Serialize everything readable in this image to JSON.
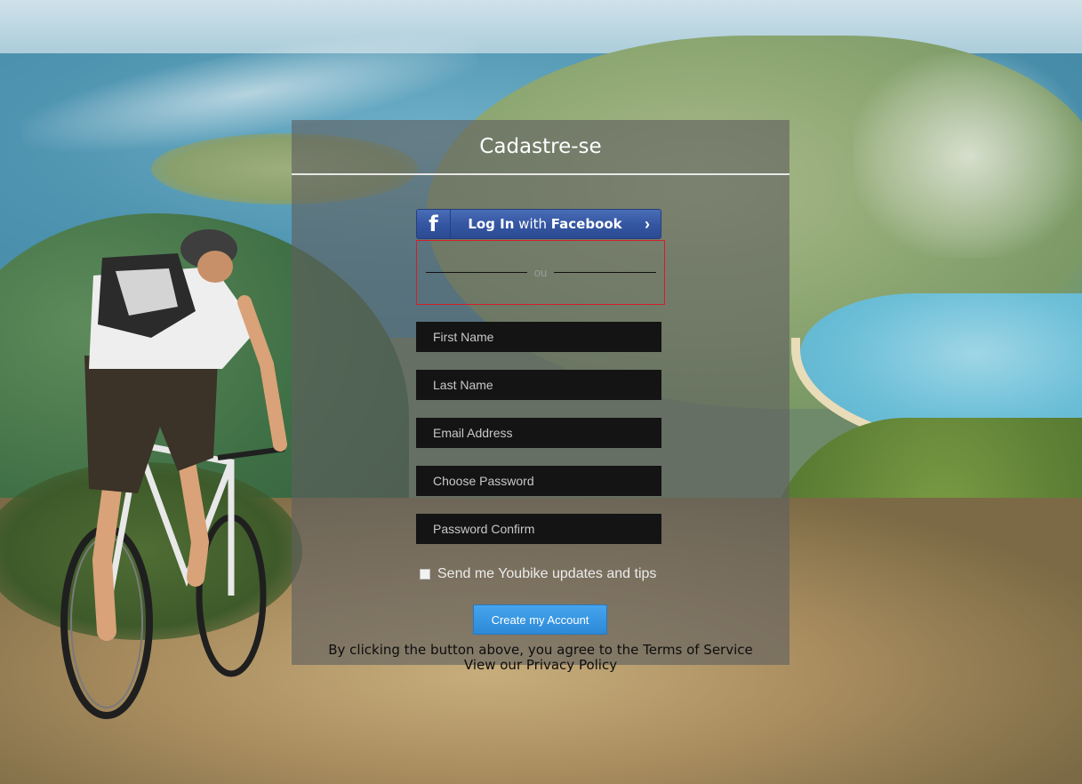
{
  "panel": {
    "title": "Cadastre-se"
  },
  "facebook": {
    "icon": "f",
    "label_bold_1": "Log In",
    "label_light": " with ",
    "label_bold_2": "Facebook",
    "chevron": "›"
  },
  "divider": {
    "text": "ou"
  },
  "form": {
    "first_name_placeholder": "First Name",
    "last_name_placeholder": "Last Name",
    "email_placeholder": "Email Address",
    "password_placeholder": "Choose Password",
    "password_confirm_placeholder": "Password Confirm",
    "updates_label": "Send me Youbike updates and tips",
    "submit_label": "Create my Account"
  },
  "footer": {
    "terms_line": "By clicking the button above, you agree to the Terms of Service",
    "privacy_line": "View our Privacy Policy"
  },
  "colors": {
    "facebook_blue": "#3557a3",
    "submit_blue": "#2c8ad8",
    "divider_border": "#d21f2c",
    "field_bg": "#141414"
  }
}
